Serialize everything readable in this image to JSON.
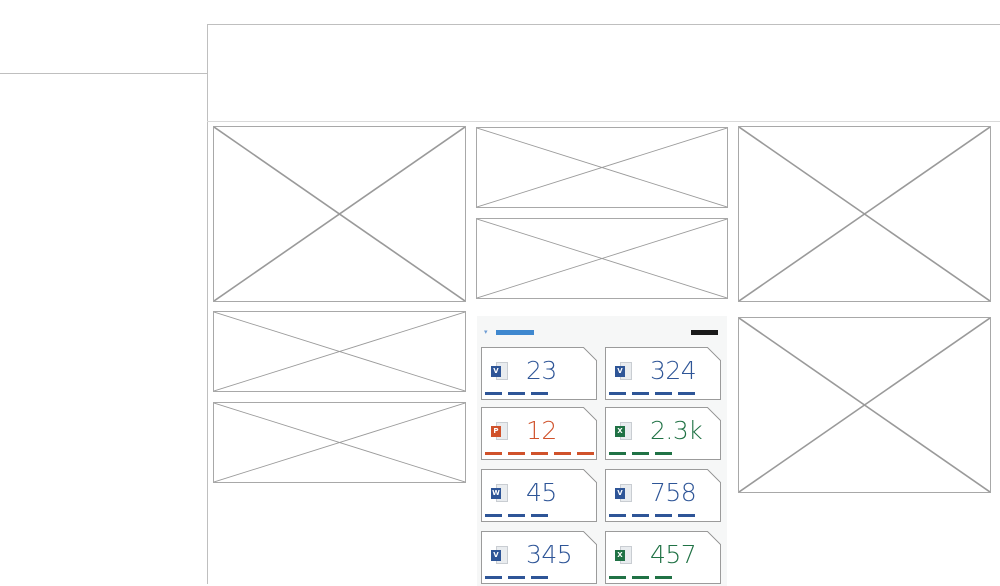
{
  "dashboard": {
    "widget": {
      "accent": "#3f88cf",
      "tiles": [
        {
          "type": "visio",
          "icon": "visio-file-icon",
          "value": "23",
          "badge": "V",
          "color": "#2e5597",
          "bars": 3
        },
        {
          "type": "visio",
          "icon": "visio-file-icon",
          "value": "324",
          "badge": "V",
          "color": "#2e5597",
          "bars": 4
        },
        {
          "type": "powerpoint",
          "icon": "powerpoint-file-icon",
          "value": "12",
          "badge": "P",
          "color": "#d0522b",
          "bars": 5
        },
        {
          "type": "excel",
          "icon": "excel-file-icon",
          "value": "2.3k",
          "badge": "X",
          "color": "#207245",
          "bars": 3
        },
        {
          "type": "word",
          "icon": "word-file-icon",
          "value": "45",
          "badge": "W",
          "color": "#2e5597",
          "bars": 3
        },
        {
          "type": "visio",
          "icon": "visio-file-icon",
          "value": "758",
          "badge": "V",
          "color": "#2e5597",
          "bars": 4
        },
        {
          "type": "visio",
          "icon": "visio-file-icon",
          "value": "345",
          "badge": "V",
          "color": "#2e5597",
          "bars": 3
        },
        {
          "type": "excel",
          "icon": "excel-file-icon",
          "value": "457",
          "badge": "X",
          "color": "#207245",
          "bars": 3
        }
      ]
    }
  }
}
